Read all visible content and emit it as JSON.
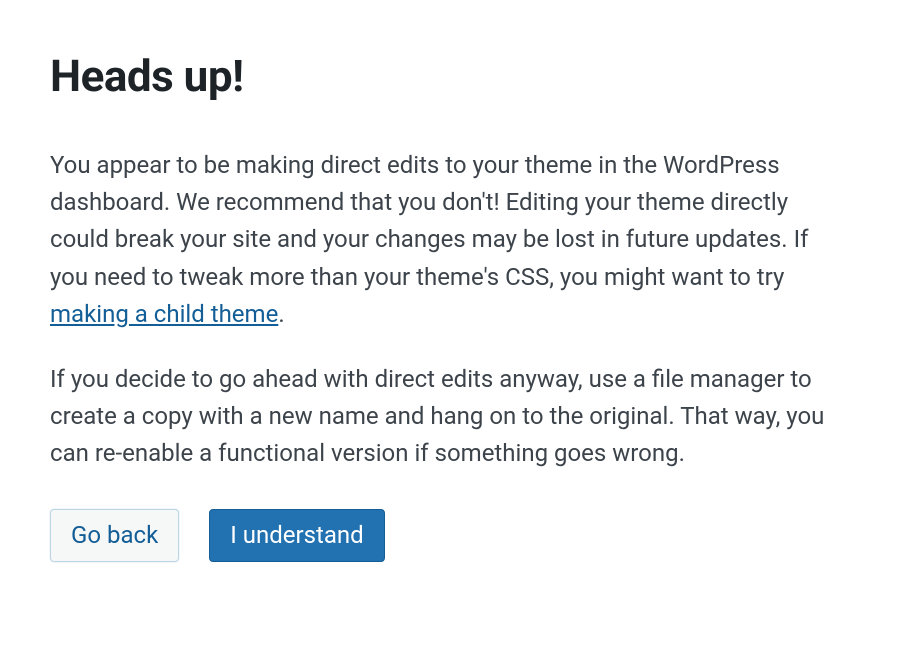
{
  "heading": "Heads up!",
  "paragraph1_part1": "You appear to be making direct edits to your theme in the WordPress dashboard. We recommend that you don't! Editing your theme directly could break your site and your changes may be lost in future updates. If you need to tweak more than your theme's CSS, you might want to try ",
  "paragraph1_link": "making a child theme",
  "paragraph1_part2": ".",
  "paragraph2": "If you decide to go ahead with direct edits anyway, use a file manager to create a copy with a new name and hang on to the original. That way, you can re-enable a functional version if something goes wrong.",
  "buttons": {
    "go_back": "Go back",
    "understand": "I understand"
  }
}
